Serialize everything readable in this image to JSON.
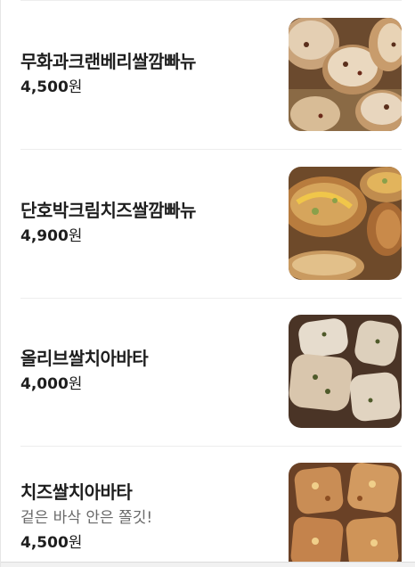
{
  "menu": {
    "items": [
      {
        "name": "무화과크랜베리쌀깜빠뉴",
        "description": "",
        "price": "4,500",
        "unit": "원",
        "image": "fig-cranberry-rice-campagne-photo"
      },
      {
        "name": "단호박크림치즈쌀깜빠뉴",
        "description": "",
        "price": "4,900",
        "unit": "원",
        "image": "pumpkin-cream-cheese-rice-campagne-photo"
      },
      {
        "name": "올리브쌀치아바타",
        "description": "",
        "price": "4,000",
        "unit": "원",
        "image": "olive-rice-ciabatta-photo"
      },
      {
        "name": "치즈쌀치아바타",
        "description": "겉은 바삭 안은 쫄깃!",
        "price": "4,500",
        "unit": "원",
        "image": "cheese-rice-ciabatta-photo"
      }
    ]
  }
}
